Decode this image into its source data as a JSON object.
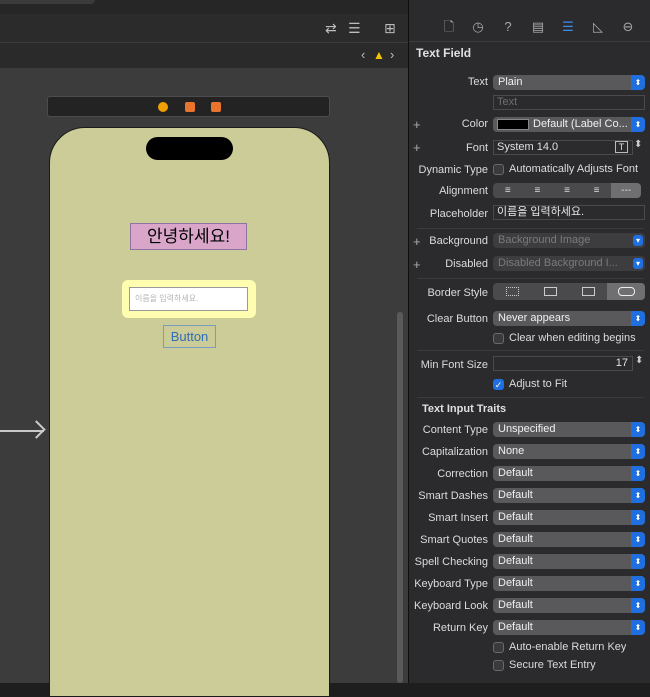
{
  "canvas": {
    "hello_label": "안녕하세요!",
    "textfield_placeholder": "이름을 입력하세요.",
    "button_label": "Button"
  },
  "inspector": {
    "section_title": "Text Field",
    "text": {
      "label": "Text",
      "value": "Plain",
      "placeholder": "Text"
    },
    "color": {
      "label": "Color",
      "value": "Default (Label Co..."
    },
    "font": {
      "label": "Font",
      "value": "System 14.0"
    },
    "dynamic_type": {
      "label": "Dynamic Type",
      "checkbox": "Automatically Adjusts Font"
    },
    "alignment": {
      "label": "Alignment"
    },
    "placeholder": {
      "label": "Placeholder",
      "value": "이름을 입력하세요."
    },
    "background": {
      "label": "Background",
      "value": "Background Image"
    },
    "disabled": {
      "label": "Disabled",
      "value": "Disabled Background I..."
    },
    "border_style": {
      "label": "Border Style"
    },
    "clear_button": {
      "label": "Clear Button",
      "value": "Never appears",
      "checkbox": "Clear when editing begins"
    },
    "min_font_size": {
      "label": "Min Font Size",
      "value": "17",
      "checkbox": "Adjust to Fit"
    },
    "traits_title": "Text Input Traits",
    "traits": [
      {
        "label": "Content Type",
        "value": "Unspecified"
      },
      {
        "label": "Capitalization",
        "value": "None"
      },
      {
        "label": "Correction",
        "value": "Default"
      },
      {
        "label": "Smart Dashes",
        "value": "Default"
      },
      {
        "label": "Smart Insert",
        "value": "Default"
      },
      {
        "label": "Smart Quotes",
        "value": "Default"
      },
      {
        "label": "Spell Checking",
        "value": "Default"
      },
      {
        "label": "Keyboard Type",
        "value": "Default"
      },
      {
        "label": "Keyboard Look",
        "value": "Default"
      },
      {
        "label": "Return Key",
        "value": "Default"
      }
    ],
    "auto_enable_return": "Auto-enable Return Key",
    "secure_text": "Secure Text Entry"
  },
  "icons": [
    "file-icon",
    "history-icon",
    "help-icon",
    "identity-icon",
    "attributes-icon",
    "size-icon",
    "connections-icon"
  ],
  "colors": {
    "accent": "#1f6fe0",
    "phone_bg": "#cccc98",
    "label_bg": "#d9a5c9"
  }
}
